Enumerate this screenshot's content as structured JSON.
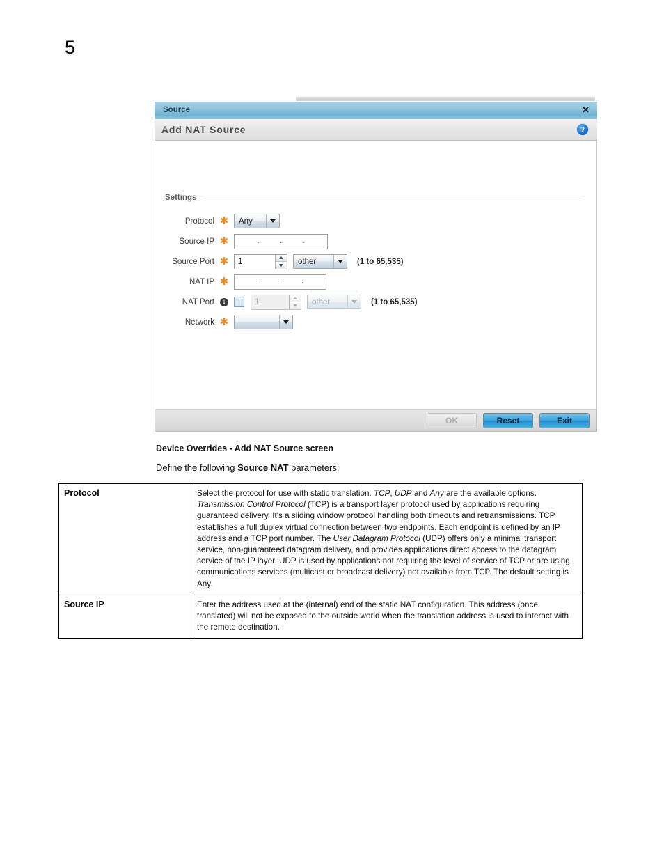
{
  "page": {
    "number": "5"
  },
  "dialog": {
    "titlebar": {
      "title": "Source",
      "close_label": "✕"
    },
    "subheader": {
      "title": "Add NAT Source",
      "help_icon": "help-circle-icon",
      "help_glyph": "?"
    },
    "section": {
      "label": "Settings"
    },
    "fields": [
      {
        "label": "Protocol",
        "marker": "required",
        "control": "dropdown",
        "value": "Any"
      },
      {
        "label": "Source IP",
        "marker": "required",
        "control": "ip-address",
        "value": [
          "",
          "",
          "",
          ""
        ]
      },
      {
        "label": "Source Port",
        "marker": "required",
        "control": "spinner-dropdown",
        "value": "1",
        "select_value": "other",
        "hint": "(1 to 65,535)"
      },
      {
        "label": "NAT IP",
        "marker": "required",
        "control": "ip-address",
        "value": [
          "",
          "",
          "",
          ""
        ]
      },
      {
        "label": "NAT Port",
        "marker": "info",
        "control": "checkbox-spinner-dropdown",
        "checked": false,
        "value": "1",
        "select_value": "other",
        "hint": "(1 to 65,535)",
        "disabled": true
      },
      {
        "label": "Network",
        "marker": "required",
        "control": "dropdown",
        "value": ""
      }
    ],
    "footer": {
      "ok_label": "OK",
      "reset_label": "Reset",
      "exit_label": "Exit"
    }
  },
  "caption": "Device Overrides - Add NAT Source screen",
  "intro": {
    "before": "Define the following ",
    "bold": "Source NAT",
    "after": " parameters:"
  },
  "parameters": [
    {
      "name": "Protocol",
      "description_html": "Select the protocol for use with static translation. <i>TCP</i>, <i>UDP</i> and <i>Any</i> are the available options. <i>Transmission Control Protocol</i> (TCP) is a transport layer protocol used by applications requiring guaranteed delivery. It's a sliding window protocol handling both timeouts and retransmissions. TCP establishes a full duplex virtual connection between two endpoints. Each endpoint is defined by an IP address and a TCP port number. The <i>User Datagram Protocol</i> (UDP) offers only a minimal transport service, non-guaranteed datagram delivery, and provides applications direct access to the datagram service of the IP layer. UDP is used by applications not requiring the level of service of TCP or are using communications services (multicast or broadcast delivery) not available from TCP. The default setting is Any."
    },
    {
      "name": "Source IP",
      "description_html": "Enter the address used at the (internal) end of the static NAT configuration. This address (once translated) will not be exposed to the outside world when the translation address is used to interact with the remote destination."
    }
  ]
}
